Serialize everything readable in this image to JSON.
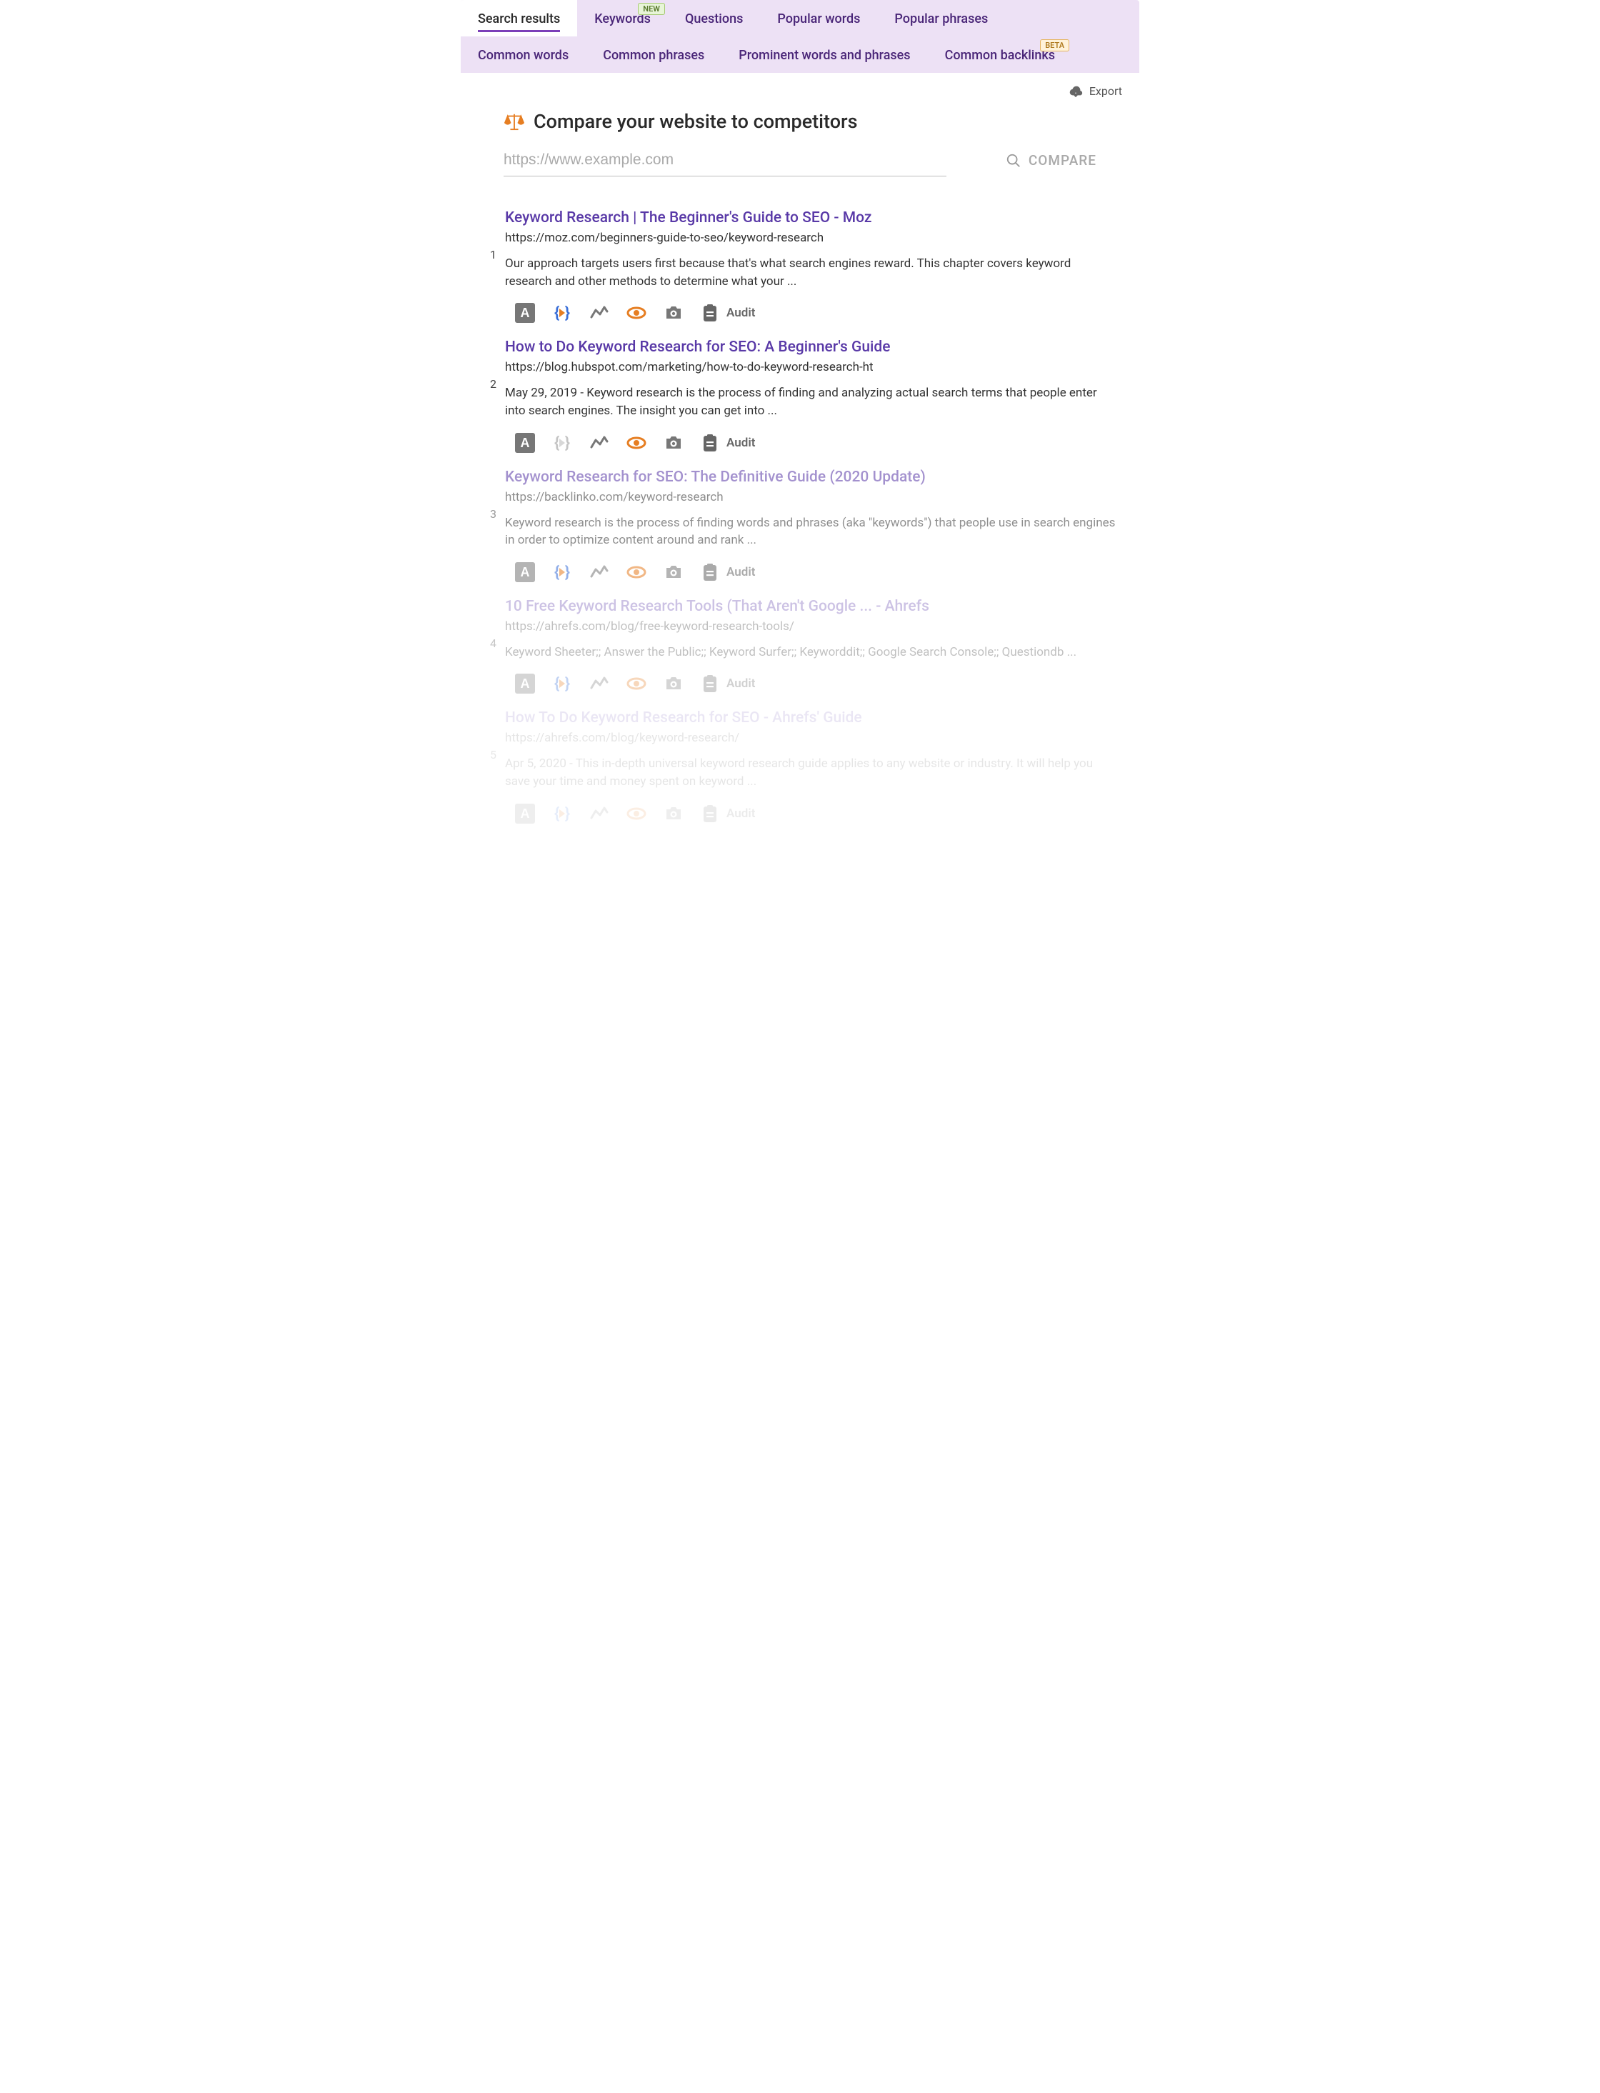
{
  "tabs_row1": [
    {
      "label": "Search results",
      "badge": null,
      "active": true
    },
    {
      "label": "Keywords",
      "badge": "NEW",
      "active": false
    },
    {
      "label": "Questions",
      "badge": null,
      "active": false
    },
    {
      "label": "Popular words",
      "badge": null,
      "active": false
    },
    {
      "label": "Popular phrases",
      "badge": null,
      "active": false
    }
  ],
  "tabs_row2": [
    {
      "label": "Common words",
      "badge": null,
      "active": false
    },
    {
      "label": "Common phrases",
      "badge": null,
      "active": false
    },
    {
      "label": "Prominent words and phrases",
      "badge": null,
      "active": false
    },
    {
      "label": "Common backlinks",
      "badge": "BETA",
      "active": false
    }
  ],
  "export_label": "Export",
  "page_title": "Compare your website to competitors",
  "url_placeholder": "https://www.example.com",
  "compare_label": "COMPARE",
  "audit_label": "Audit",
  "results": [
    {
      "title": "Keyword Research | The Beginner's Guide to SEO - Moz",
      "url": "https://moz.com/beginners-guide-to-seo/keyword-research",
      "desc": "Our approach targets users first because that's what search engines reward. This chapter covers keyword research and other methods to determine what your ...",
      "schema": true,
      "fade": ""
    },
    {
      "title": "How to Do Keyword Research for SEO: A Beginner's Guide",
      "url": "https://blog.hubspot.com/marketing/how-to-do-keyword-research-ht",
      "desc": "May 29, 2019 - Keyword research is the process of finding and analyzing actual search terms that people enter into search engines. The insight you can get into ...",
      "schema": false,
      "fade": ""
    },
    {
      "title": "Keyword Research for SEO: The Definitive Guide (2020 Update)",
      "url": "https://backlinko.com/keyword-research",
      "desc": "Keyword research is the process of finding words and phrases (aka \"keywords\") that people use in search engines in order to optimize content around and rank ...",
      "schema": true,
      "fade": "fade1"
    },
    {
      "title": "10 Free Keyword Research Tools (That Aren't Google ... - Ahrefs",
      "url": "https://ahrefs.com/blog/free-keyword-research-tools/",
      "desc": "Keyword Sheeter;; Answer the Public;; Keyword Surfer;; Keyworddit;; Google Search Console;; Questiondb ...",
      "schema": true,
      "fade": "fade2"
    },
    {
      "title": "How To Do Keyword Research for SEO - Ahrefs' Guide",
      "url": "https://ahrefs.com/blog/keyword-research/",
      "desc": "Apr 5, 2020 - This in-depth universal keyword research guide applies to any website or industry. It will help you save your time and money spent on keyword ...",
      "schema": true,
      "fade": "fade3"
    }
  ]
}
